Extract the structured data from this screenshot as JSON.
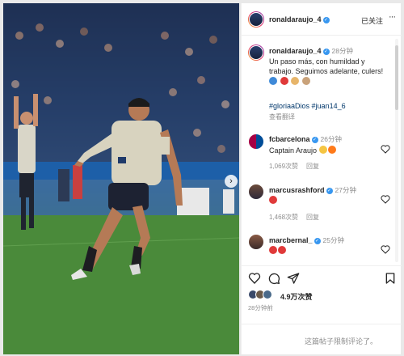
{
  "post": {
    "username": "ronaldaraujo_4",
    "follow_status": "已关注",
    "more_icon": "more-horizontal-icon",
    "caption": {
      "username": "ronaldaraujo_4",
      "time": "28分钟",
      "text_line1": "Un paso más, con humildad y",
      "text_line2": "trabajo. Seguimos adelante, culers!",
      "emojis": [
        "blue-heart-emoji",
        "red-heart-emoji",
        "flexed-biceps-emoji",
        "pray-emoji"
      ],
      "hashtag1": "#gloriaaDios",
      "hashtag2": "#juan14_6",
      "translate": "查看翻译"
    },
    "comments": [
      {
        "username": "fcbarcelona",
        "time": "26分钟",
        "text": "Captain Araujo",
        "emojis": [
          "star-struck-emoji",
          "fire-emoji"
        ],
        "likes": "1,069次赞",
        "reply": "回复"
      },
      {
        "username": "marcusrashford",
        "time": "27分钟",
        "emojis": [
          "red-heart-emoji"
        ],
        "likes": "1,468次赞",
        "reply": "回复"
      },
      {
        "username": "marcbernal_",
        "time": "25分钟",
        "emojis": [
          "red-heart-emoji",
          "red-heart-emoji"
        ]
      }
    ],
    "likes_total": "4.9万次赞",
    "posted_time": "28分钟前",
    "comments_closed": "这篇帖子限制评论了。"
  },
  "icons": {
    "like": "heart-icon",
    "comment": "comment-icon",
    "share": "send-icon",
    "save": "bookmark-icon",
    "carousel_next": "chevron-right-icon"
  },
  "colors": {
    "link": "#00376b",
    "verified": "#3897f0",
    "heart_red": "#ed4956",
    "meta_gray": "#8e8e8e"
  }
}
